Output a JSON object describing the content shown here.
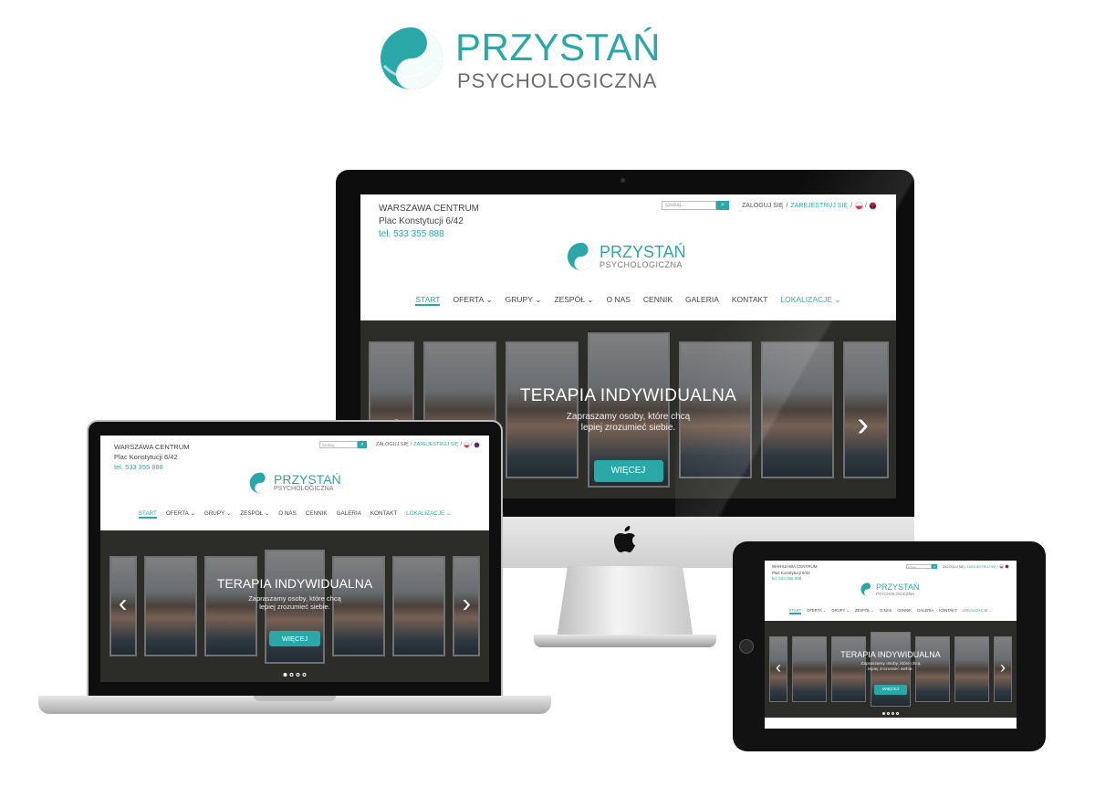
{
  "brand": {
    "name_line1": "PRZYSTAŃ",
    "name_line2": "PSYCHOLOGICZNA",
    "logo_icon": "yin-yang-wave-icon",
    "accent_color": "#2aa8a8"
  },
  "site": {
    "address": {
      "city": "WARSZAWA CENTRUM",
      "street": "Plac Konstytucji 6/42",
      "phone": "tel. 533 355 888"
    },
    "topbar": {
      "search_placeholder": "szukaj...",
      "search_icon": "search-icon",
      "login": "ZALOGUJ SIĘ",
      "separator": "/",
      "register": "ZAREJESTRUJ SIĘ",
      "languages": [
        "pl-flag-icon",
        "gb-flag-icon"
      ]
    },
    "logo": {
      "line1": "PRZYSTAŃ",
      "line2": "PSYCHOLOGICZNA"
    },
    "nav": [
      {
        "label": "START",
        "active": true
      },
      {
        "label": "OFERTA",
        "dropdown": true
      },
      {
        "label": "GRUPY",
        "dropdown": true
      },
      {
        "label": "ZESPÓŁ",
        "dropdown": true
      },
      {
        "label": "O NAS"
      },
      {
        "label": "CENNIK"
      },
      {
        "label": "GALERIA"
      },
      {
        "label": "KONTAKT"
      },
      {
        "label": "LOKALIZACJE",
        "dropdown": true
      }
    ],
    "nav_chevron": "⌄",
    "hero": {
      "title": "TERAPIA INDYWIDUALNA",
      "subtitle_line1": "Zapraszamy osoby, które chcą",
      "subtitle_line2": "lepiej zrozumieć siebie.",
      "button": "WIĘCEJ",
      "prev_icon": "chevron-left-icon",
      "next_icon": "chevron-right-icon",
      "slides_total": 4,
      "slide_active": 1
    }
  },
  "devices": {
    "desktop_logo_icon": "apple-logo-icon",
    "apple_glyph": ""
  }
}
